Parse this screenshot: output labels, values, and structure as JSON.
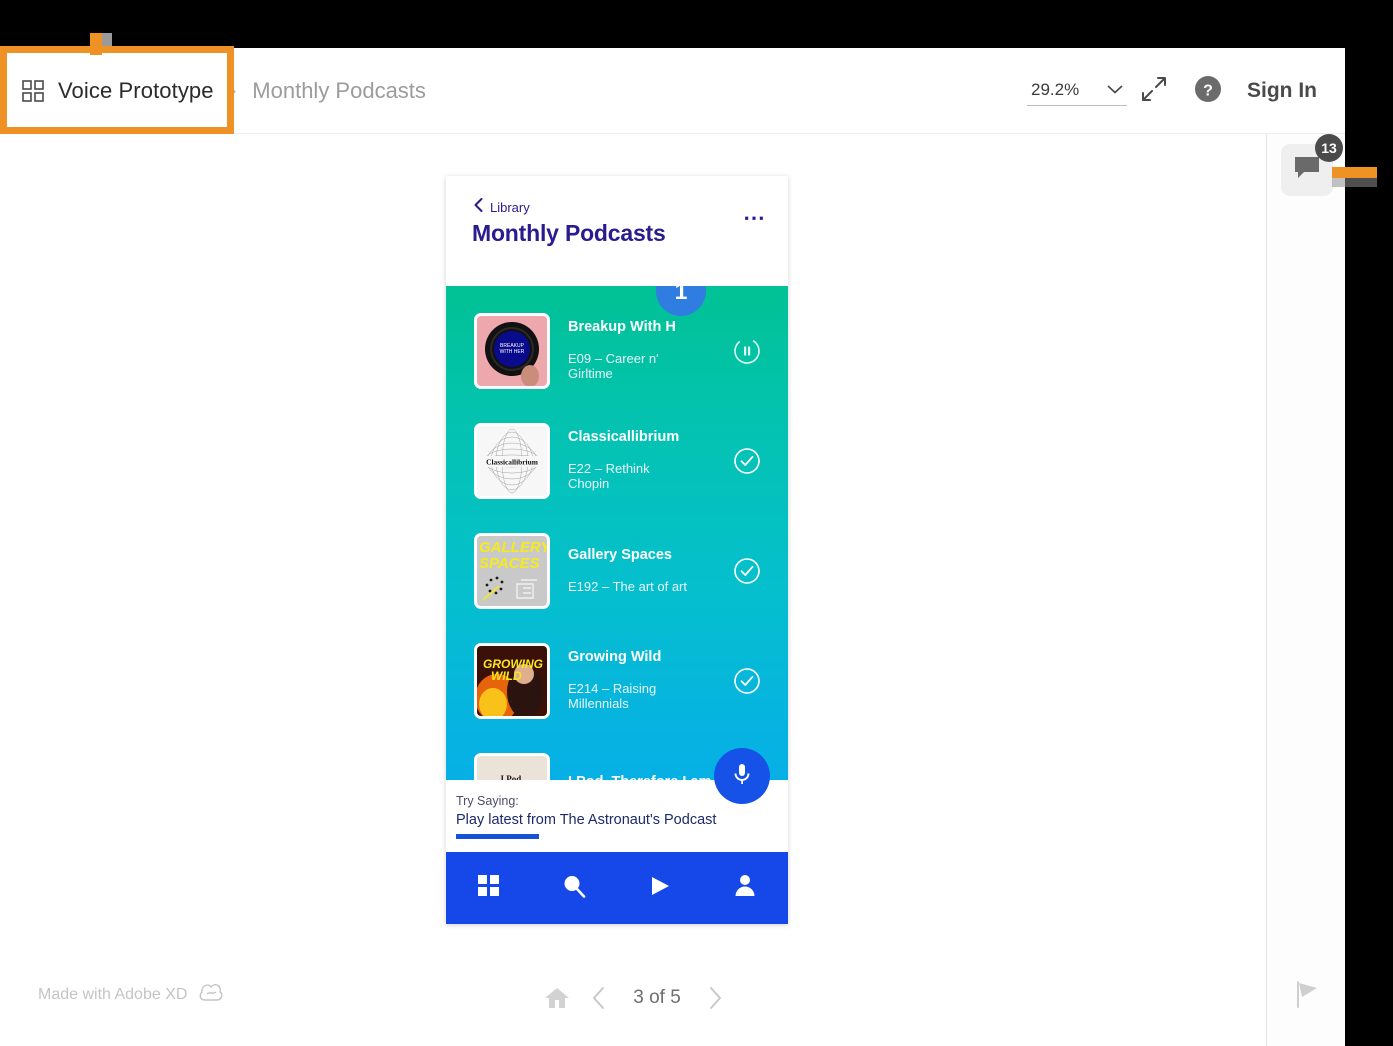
{
  "header": {
    "grid_icon": "grid-icon",
    "breadcrumb_home": "Voice Prototype",
    "breadcrumb_separator": "›",
    "breadcrumb_current": "Monthly Podcasts",
    "zoom_value": "29.2%",
    "chevron_icon": "chevron-down-icon",
    "fullscreen_icon": "expand-arrows-icon",
    "help_icon": "help-circle-icon",
    "sign_in_label": "Sign In"
  },
  "right_rail": {
    "comment_icon": "comment-bubble-icon",
    "comment_count": "13",
    "flag_icon": "flag-icon"
  },
  "phone": {
    "back_label": "Library",
    "back_icon": "chevron-left-icon",
    "title": "Monthly Podcasts",
    "overflow_icon": "ellipsis-icon",
    "marker_badge": "1",
    "items": [
      {
        "title": "Breakup With H",
        "subtitle": "E09 – Career n' Girltime",
        "thumb_label": "BREAKUP WITH HER",
        "action_icon": "pause-circle-icon",
        "state": "playing"
      },
      {
        "title": "Classicallibrium",
        "subtitle": "E22 – Rethink Chopin",
        "thumb_label": "Classicallibrium",
        "action_icon": "check-circle-icon",
        "state": "completed"
      },
      {
        "title": "Gallery Spaces",
        "subtitle": "E192 – The art of art",
        "thumb_label": "GALLERY SPACES",
        "action_icon": "check-circle-icon",
        "state": "completed"
      },
      {
        "title": "Growing Wild",
        "subtitle": "E214 – Raising Millennials",
        "thumb_label": "GROWING WILD",
        "action_icon": "check-circle-icon",
        "state": "completed"
      },
      {
        "title": "I Pod, Therefore I am",
        "subtitle": "",
        "thumb_label": "I Pod, Therefore I Am",
        "action_icon": "",
        "state": ""
      }
    ],
    "try_saying_label": "Try Saying:",
    "try_saying_phrase": "Play latest from The Astronaut's Podcast",
    "mic_icon": "microphone-icon",
    "tabs": [
      {
        "icon": "grid-squares-icon",
        "name": "browse"
      },
      {
        "icon": "search-icon",
        "name": "search"
      },
      {
        "icon": "play-triangle-icon",
        "name": "play"
      },
      {
        "icon": "person-icon",
        "name": "profile"
      }
    ]
  },
  "footer": {
    "made_with": "Made with Adobe XD",
    "cc_icon": "creative-cloud-icon",
    "home_icon": "home-icon",
    "prev_icon": "chevron-left-icon",
    "next_icon": "chevron-right-icon",
    "page_indicator": "3 of 5"
  },
  "colors": {
    "annotation": "#ef9226",
    "brand_purple": "#2a1b8f",
    "tabbar_blue": "#1647e8",
    "badge_blue": "#2f7de1",
    "gradient_top": "#00c08f",
    "gradient_bottom": "#03a9ef"
  }
}
